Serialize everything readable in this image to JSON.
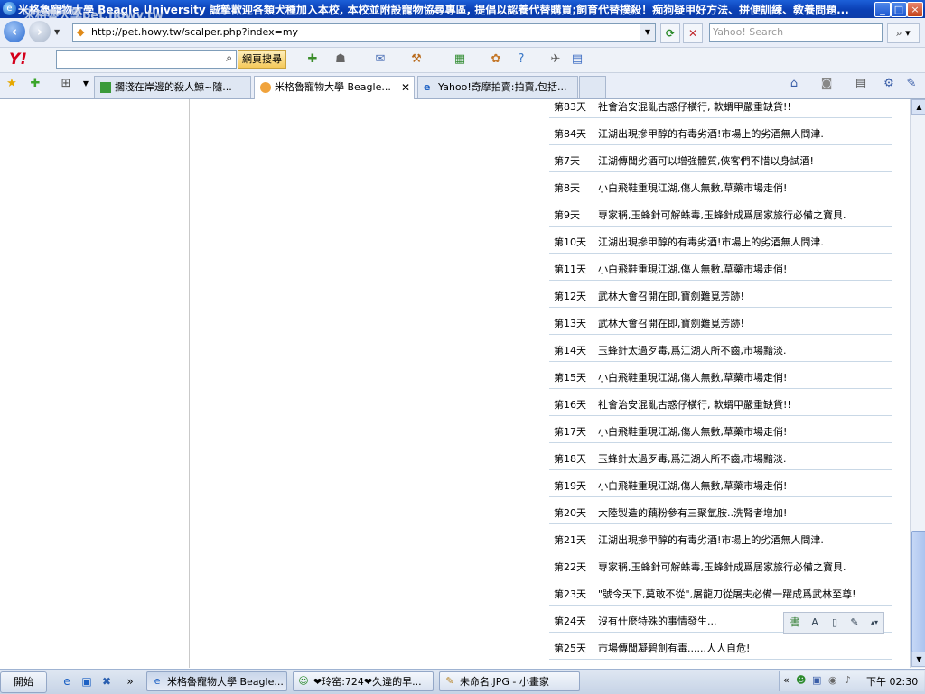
{
  "window": {
    "title": "米格魯寵物大學 Beagle University 誠摯歡迎各類犬種加入本校, 本校並附設寵物協尋專區, 提倡以認養代替購買;飼育代替撲殺！痴狗疑甲好方法、拼便訓練、敎養問題...",
    "ghost_watermark": "米格魯大學pet.howy.tw",
    "minimize": "_",
    "maximize": "□",
    "close": "×"
  },
  "address_bar": {
    "url": "http://pet.howy.tw/scalper.php?index=my",
    "search_placeholder": "Yahoo! Search"
  },
  "yahoo_toolbar": {
    "logo": "Y!",
    "search_button": "網頁搜尋"
  },
  "tabs": [
    {
      "label": "擱淺在岸邊的殺人鯨~隨...",
      "icon": "green-page-icon"
    },
    {
      "label": "米格魯寵物大學 Beagle...",
      "icon": "orange-dog-icon",
      "active": true
    },
    {
      "label": "Yahoo!奇摩拍賣:拍賣,包括...",
      "icon": "ie-icon"
    }
  ],
  "content": {
    "rows": [
      {
        "day": "第83天",
        "msg": "社會治安混亂古惑仔橫行, 軟蝟甲嚴重缺貨!!"
      },
      {
        "day": "第84天",
        "msg": "江湖出現摻甲醇的有毒劣酒!市場上的劣酒無人問津."
      },
      {
        "day": "第7天",
        "msg": "江湖傳聞劣酒可以增強體質,俠客們不惜以身試酒!"
      },
      {
        "day": "第8天",
        "msg": "小白飛鞋重現江湖,傷人無數,草藥市場走俏!"
      },
      {
        "day": "第9天",
        "msg": "專家稱,玉蜂針可解蛛毒,玉蜂針成爲居家旅行必備之寶貝."
      },
      {
        "day": "第10天",
        "msg": "江湖出現摻甲醇的有毒劣酒!市場上的劣酒無人問津."
      },
      {
        "day": "第11天",
        "msg": "小白飛鞋重現江湖,傷人無數,草藥市場走俏!"
      },
      {
        "day": "第12天",
        "msg": "武林大會召開在即,寶劍難覓芳跡!"
      },
      {
        "day": "第13天",
        "msg": "武林大會召開在即,寶劍難覓芳跡!"
      },
      {
        "day": "第14天",
        "msg": "玉蜂針太過歹毒,爲江湖人所不齒,市場黯淡."
      },
      {
        "day": "第15天",
        "msg": "小白飛鞋重現江湖,傷人無數,草藥市場走俏!"
      },
      {
        "day": "第16天",
        "msg": "社會治安混亂古惑仔橫行, 軟蝟甲嚴重缺貨!!"
      },
      {
        "day": "第17天",
        "msg": "小白飛鞋重現江湖,傷人無數,草藥市場走俏!"
      },
      {
        "day": "第18天",
        "msg": "玉蜂針太過歹毒,爲江湖人所不齒,市場黯淡."
      },
      {
        "day": "第19天",
        "msg": "小白飛鞋重現江湖,傷人無數,草藥市場走俏!"
      },
      {
        "day": "第20天",
        "msg": "大陸製造的藕粉參有三聚氫胺..洗腎者增加!"
      },
      {
        "day": "第21天",
        "msg": "江湖出現摻甲醇的有毒劣酒!市場上的劣酒無人問津."
      },
      {
        "day": "第22天",
        "msg": "專家稱,玉蜂針可解蛛毒,玉蜂針成爲居家旅行必備之寶貝."
      },
      {
        "day": "第23天",
        "msg": "\"號令天下,莫敢不從\",屠龍刀從屠夫必備一躍成爲武林至尊!"
      },
      {
        "day": "第24天",
        "msg": "沒有什麼特殊的事情發生..."
      },
      {
        "day": "第25天",
        "msg": "市場傳聞凝碧劍有毒......人人自危!"
      }
    ]
  },
  "taskbar": {
    "start_label": "開始",
    "tasks": [
      {
        "label": "米格魯寵物大學 Beagle...",
        "active": true
      },
      {
        "label": "❤玲窑:724❤久違的早..."
      },
      {
        "label": "未命名.JPG - 小畫家"
      }
    ],
    "clock": "下午 02:30"
  }
}
